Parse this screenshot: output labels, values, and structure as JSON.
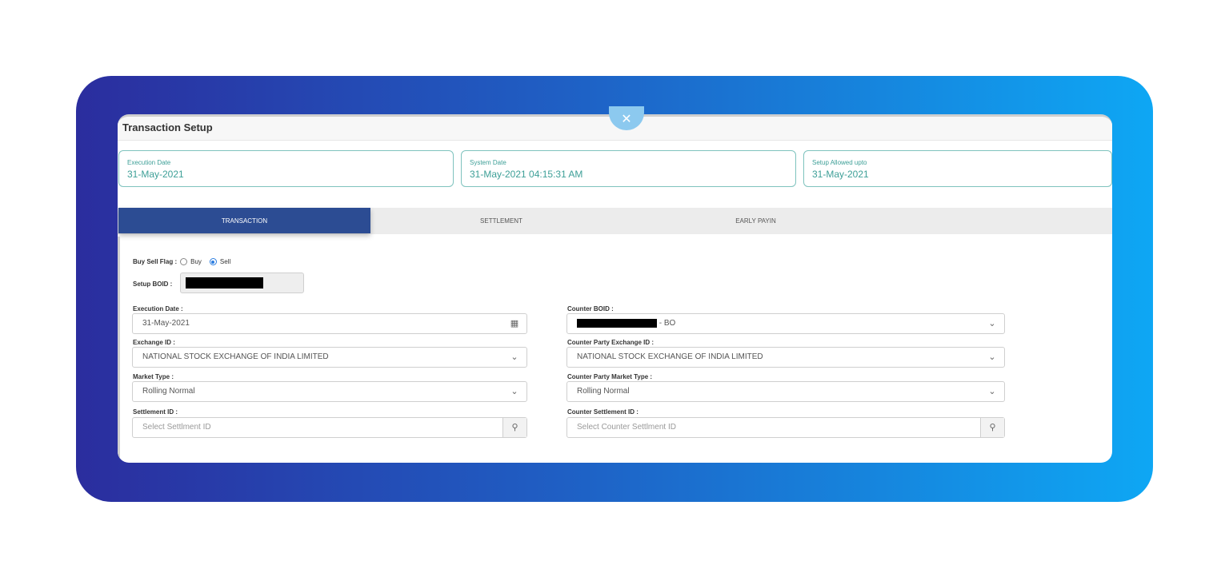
{
  "title": "Transaction Setup",
  "info_cards": [
    {
      "label": "Execution Date",
      "value": "31-May-2021"
    },
    {
      "label": "System Date",
      "value": "31-May-2021 04:15:31 AM"
    },
    {
      "label": "Setup Allowed upto",
      "value": "31-May-2021"
    }
  ],
  "tabs": [
    {
      "label": "TRANSACTION",
      "active": true
    },
    {
      "label": "SETTLEMENT",
      "active": false
    },
    {
      "label": "EARLY PAYIN",
      "active": false
    }
  ],
  "buy_sell": {
    "label": "Buy Sell Flag :",
    "options": [
      "Buy",
      "Sell"
    ],
    "selected": "Sell"
  },
  "setup_boid": {
    "label": "Setup BOID :"
  },
  "left_fields": [
    {
      "label": "Execution Date :",
      "value": "31-May-2021",
      "icon": "calendar-icon"
    },
    {
      "label": "Exchange ID :",
      "value": "NATIONAL STOCK EXCHANGE OF INDIA LIMITED",
      "icon": "chevron-down-icon"
    },
    {
      "label": "Market Type :",
      "value": "Rolling Normal",
      "icon": "chevron-down-icon"
    },
    {
      "label": "Settlement ID :",
      "placeholder": "Select Settlment ID",
      "icon": "search-icon"
    }
  ],
  "right_fields": [
    {
      "label": "Counter BOID :",
      "value_suffix": "- BO",
      "icon": "chevron-down-icon"
    },
    {
      "label": "Counter Party Exchange ID :",
      "value": "NATIONAL STOCK EXCHANGE OF INDIA LIMITED",
      "icon": "chevron-down-icon"
    },
    {
      "label": "Counter Party Market Type :",
      "value": "Rolling Normal",
      "icon": "chevron-down-icon"
    },
    {
      "label": "Counter Settlement ID :",
      "placeholder": "Select Counter Settlment ID",
      "icon": "search-icon"
    }
  ],
  "colors": {
    "accent": "#2c4c93",
    "card_text": "#3d9f97",
    "gradient_start": "#2b2d9e",
    "gradient_end": "#0ea7f4"
  }
}
